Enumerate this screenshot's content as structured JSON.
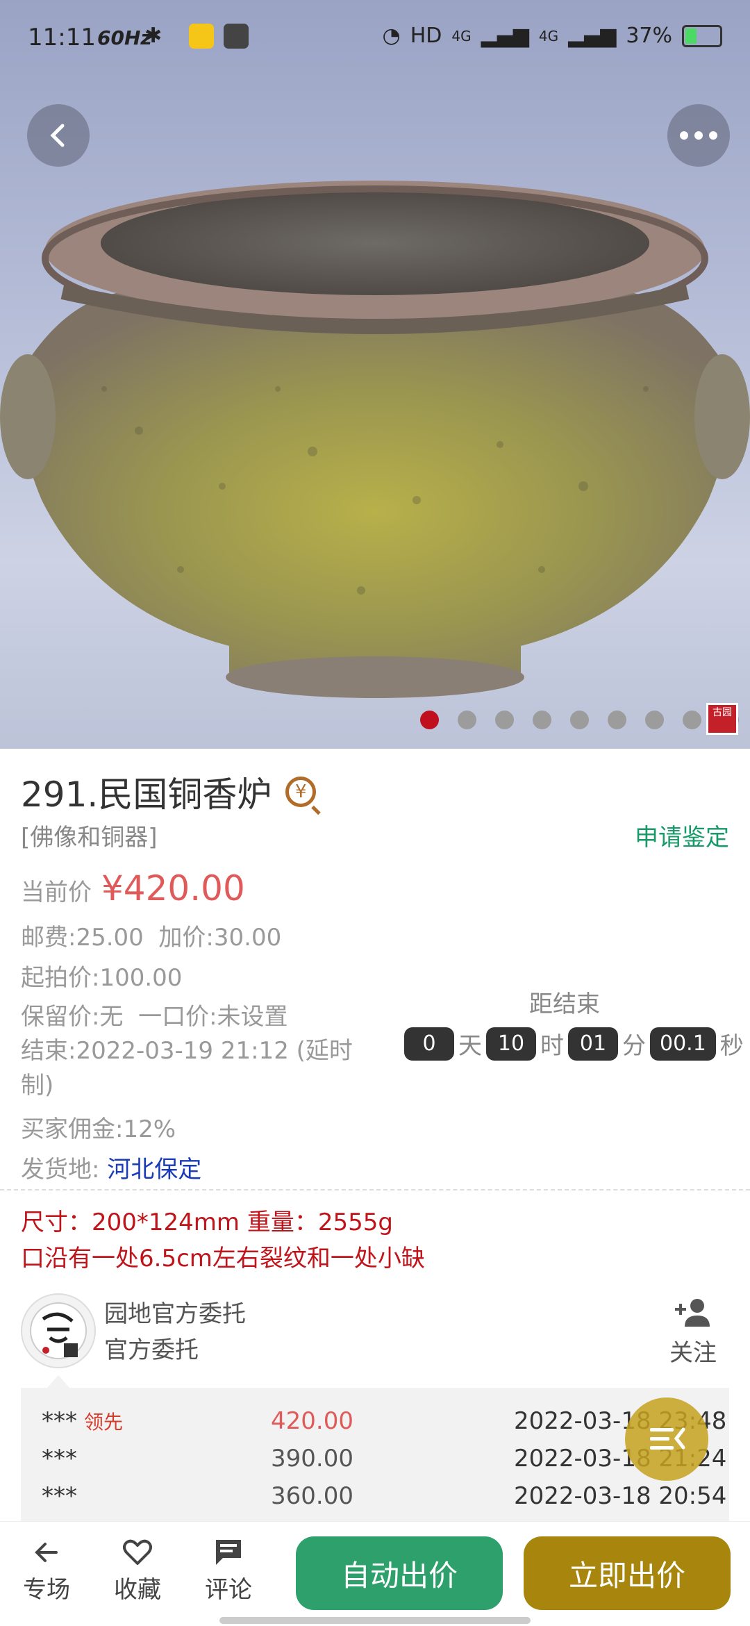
{
  "status_bar": {
    "time": "11:11",
    "refresh_rate": "60Hz",
    "network": "HD",
    "signal_a": "4G",
    "signal_b": "4G",
    "battery": "37%",
    "battery_level": 0.37
  },
  "gallery": {
    "image_count": 9,
    "active_index": 0,
    "seal_text": "古园"
  },
  "lot": {
    "title": "291.民国铜香炉",
    "category": "[佛像和铜器]",
    "appraise_link": "申请鉴定",
    "current_price_label": "当前价",
    "current_price": "¥420.00",
    "shipping_fee": "邮费:25.00",
    "increment": "加价:30.00",
    "start_price": "起拍价:100.00",
    "reserve": "保留价:无",
    "buy_now": "一口价:未设置",
    "end_time": "结束:2022-03-19 21:12 (延时制)",
    "commission": "买家佣金:12%",
    "ship_from_label": "发货地:",
    "ship_from": "河北保定"
  },
  "countdown": {
    "label": "距结束",
    "days": "0",
    "days_unit": "天",
    "hours": "10",
    "hours_unit": "时",
    "minutes": "01",
    "minutes_unit": "分",
    "seconds": "00.1",
    "seconds_unit": "秒"
  },
  "description": {
    "line1": "尺寸：200*124mm 重量：2555g",
    "line2": "口沿有一处6.5cm左右裂纹和一处小缺"
  },
  "seller": {
    "name": "园地官方委托",
    "subtitle": "官方委托",
    "follow_label": "关注"
  },
  "bids": [
    {
      "user": "***",
      "tag": "领先",
      "price": "420.00",
      "time": "2022-03-18 23:48"
    },
    {
      "user": "***",
      "tag": "",
      "price": "390.00",
      "time": "2022-03-18 21:24"
    },
    {
      "user": "***",
      "tag": "",
      "price": "360.00",
      "time": "2022-03-18 20:54"
    }
  ],
  "bottom_bar": {
    "tab_venue": "专场",
    "tab_favorite": "收藏",
    "tab_comment": "评论",
    "auto_bid": "自动出价",
    "bid_now": "立即出价"
  },
  "colors": {
    "price_red": "#e05a5a",
    "accent_green": "#2ea06b",
    "gold": "#a8860e",
    "desc_red": "#c0141b",
    "link_blue": "#1a3bb8"
  }
}
